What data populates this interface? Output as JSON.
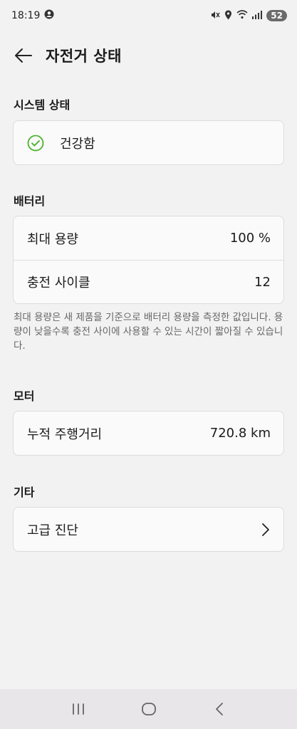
{
  "status_bar": {
    "time": "18:19",
    "battery_level": "52",
    "icons": [
      "account-circle-icon",
      "mute-vibrate-icon",
      "location-icon",
      "wifi-icon",
      "signal-icon",
      "battery-icon"
    ]
  },
  "header": {
    "title": "자전거 상태",
    "back_icon": "arrow-left-icon"
  },
  "system_status": {
    "section_label": "시스템 상태",
    "status_text": "건강함",
    "status_icon": "check-circle-icon",
    "status_color": "#4cb32f"
  },
  "battery": {
    "section_label": "배터리",
    "max_capacity_label": "최대 용량",
    "max_capacity_value": "100 %",
    "charge_cycles_label": "충전 사이클",
    "charge_cycles_value": "12",
    "note": "최대 용량은 새 제품을 기준으로 배터리 용량을 측정한 값입니다. 용량이 낮을수록 충전 사이에 사용할 수 있는 시간이 짧아질 수 있습니다."
  },
  "motor": {
    "section_label": "모터",
    "odometer_label": "누적 주행거리",
    "odometer_value": "720.8 km"
  },
  "other": {
    "section_label": "기타",
    "advanced_diagnostics_label": "고급 진단",
    "chevron_icon": "chevron-right-icon"
  },
  "nav_bar": {
    "buttons": [
      "recent-apps-icon",
      "home-icon",
      "back-icon"
    ]
  }
}
